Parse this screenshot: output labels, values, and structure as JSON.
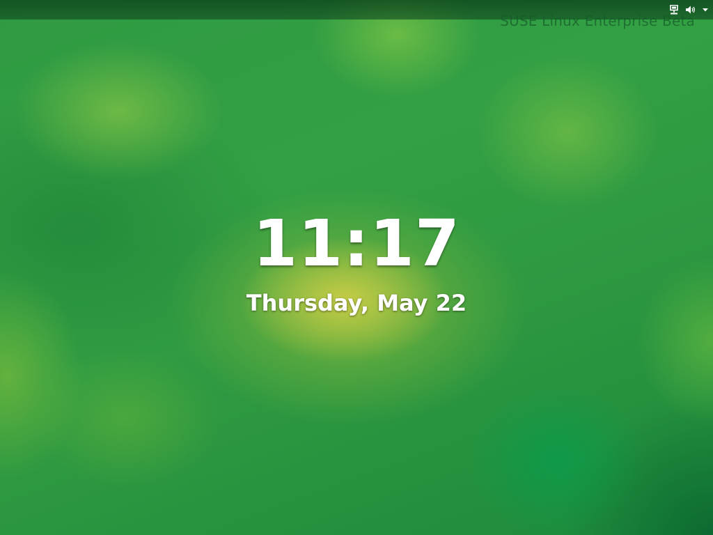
{
  "topbar": {
    "watermark": "SUSE Linux Enterprise Beta",
    "status_icons": [
      "network-wired-icon",
      "volume-icon",
      "system-menu-arrow-icon"
    ]
  },
  "lock_screen": {
    "time": "11:17",
    "date": "Thursday, May 22"
  },
  "colors": {
    "background_green": "#30a044",
    "highlight_yellow": "#c8cd46",
    "text": "#ffffff"
  }
}
